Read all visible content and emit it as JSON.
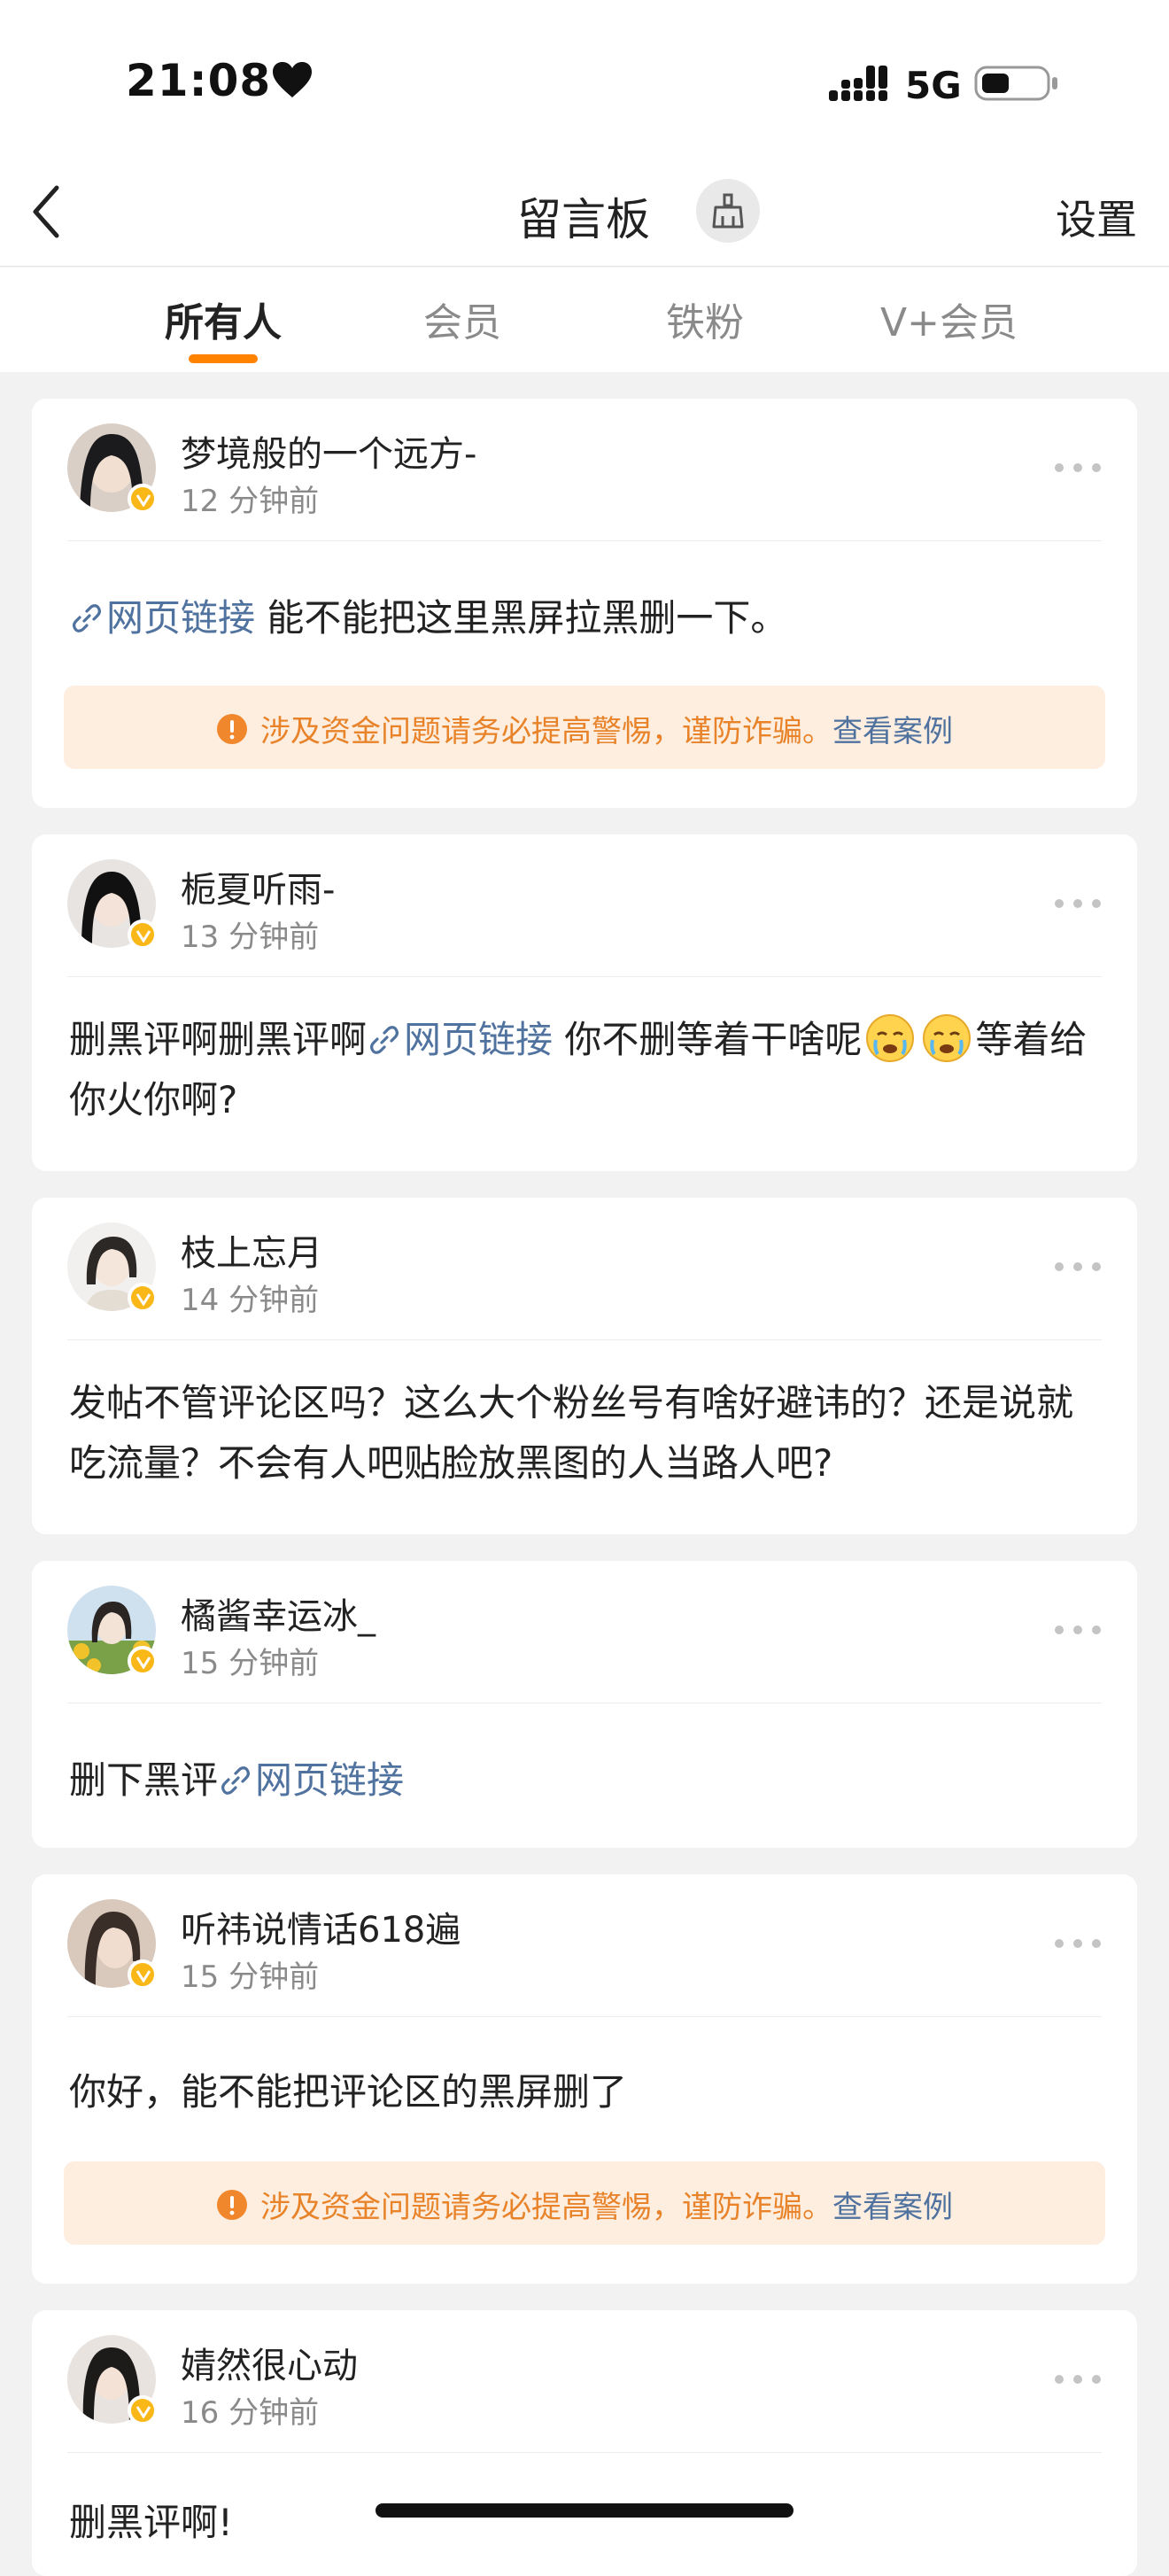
{
  "status": {
    "time": "21:08",
    "network": "5G"
  },
  "nav": {
    "title": "留言板",
    "settings": "设置"
  },
  "tabs": [
    {
      "label": "所有人"
    },
    {
      "label": "会员"
    },
    {
      "label": "铁粉"
    },
    {
      "label": "V+会员"
    }
  ],
  "link_label": "网页链接",
  "warning": {
    "text": "涉及资金问题请务必提高警惕，谨防诈骗。",
    "link": "查看案例"
  },
  "posts": [
    {
      "name": "梦境般的一个远方-",
      "time": "12 分钟前",
      "after_link": " 能不能把这里黑屏拉黑删一下。"
    },
    {
      "name": "栀夏听雨-",
      "time": "13 分钟前",
      "before_link": "删黑评啊删黑评啊",
      "after_link": " 你不删等着干啥呢",
      "after_emoji": "等着给你火你啊?"
    },
    {
      "name": "枝上忘月",
      "time": "14 分钟前",
      "text": "发帖不管评论区吗？这么大个粉丝号有啥好避讳的？还是说就吃流量？不会有人吧贴脸放黑图的人当路人吧?"
    },
    {
      "name": "橘酱幸运冰_",
      "time": "15 分钟前",
      "before_link": "删下黑评"
    },
    {
      "name": "听祎说情话618遍",
      "time": "15 分钟前",
      "text": "你好，能不能把评论区的黑屏删了"
    },
    {
      "name": "婧然很心动",
      "time": "16 分钟前",
      "text": "删黑评啊!"
    }
  ],
  "colors": {
    "accent": "#ff8200",
    "link": "#50729f",
    "warn_bg": "#fdeee0",
    "warn_text": "#e8832a",
    "vbadge": "#f9b718"
  }
}
